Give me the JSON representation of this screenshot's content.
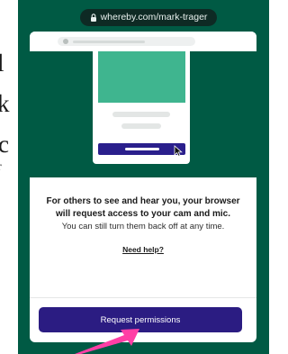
{
  "browser": {
    "url": "whereby.com/mark-trager"
  },
  "page": {
    "headline": "For others to see and hear you, your browser will request access to your cam and mic.",
    "subtext": "You can still turn them back off at any time.",
    "help_link": "Need help?",
    "primary_button": "Request permissions"
  },
  "background_text": [
    "l",
    "k",
    "c",
    "r"
  ],
  "colors": {
    "phone_background": "#005a44",
    "illustration_green": "#3fb58f",
    "button_purple": "#2b1c82",
    "annotation_arrow": "#ff3ea5"
  },
  "icons": {
    "url_bar": "lock-icon",
    "mock_pointer": "mouse-cursor-icon",
    "annotation": "pink-arrow-icon"
  }
}
